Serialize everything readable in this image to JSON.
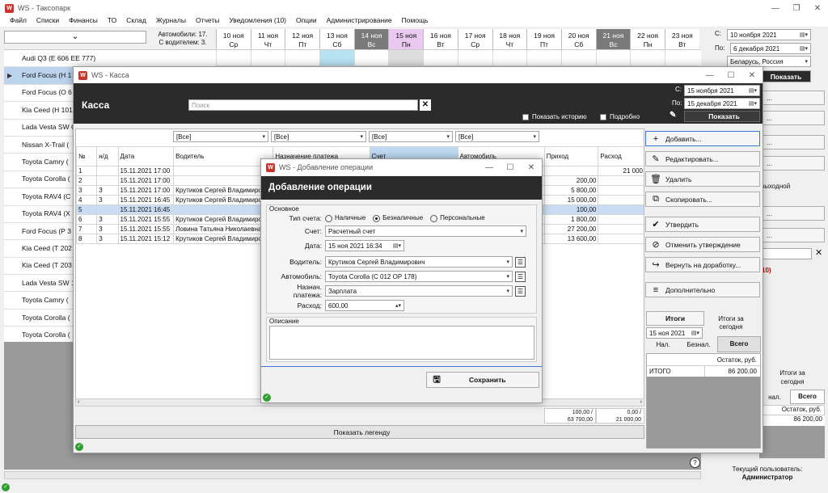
{
  "app": {
    "title": "WS - Таксопарк"
  },
  "menu": [
    "Файл",
    "Списки",
    "Финансы",
    "ТО",
    "Склад",
    "Журналы",
    "Отчеты",
    "Уведомления (10)",
    "Опции",
    "Администрирование",
    "Помощь"
  ],
  "schedule": {
    "cars_stat_1": "Автомобили: 17.",
    "cars_stat_2": "С водителем: 3.",
    "days": [
      {
        "d": "10 ноя",
        "w": "Ср"
      },
      {
        "d": "11 ноя",
        "w": "Чт"
      },
      {
        "d": "12 ноя",
        "w": "Пт"
      },
      {
        "d": "13 ноя",
        "w": "Сб"
      },
      {
        "d": "14 ноя",
        "w": "Вс"
      },
      {
        "d": "15 ноя",
        "w": "Пн"
      },
      {
        "d": "16 ноя",
        "w": "Вт"
      },
      {
        "d": "17 ноя",
        "w": "Ср"
      },
      {
        "d": "18 ноя",
        "w": "Чт"
      },
      {
        "d": "19 ноя",
        "w": "Пт"
      },
      {
        "d": "20 ноя",
        "w": "Сб"
      },
      {
        "d": "21 ноя",
        "w": "Вс"
      },
      {
        "d": "22 ноя",
        "w": "Пн"
      },
      {
        "d": "23 ноя",
        "w": "Вт"
      }
    ]
  },
  "cars": [
    "Audi Q3 (Е 606 ЕЕ 777)",
    "Ford Focus (Н 1",
    "Ford Focus (О 6",
    "Kia Ceed (Н 101",
    "Lada Vesta SW C 777)",
    "Nissan X-Trail (",
    "Toyota Camry (",
    "Toyota Corolla (",
    "Toyota RAV4 (С",
    "Toyota RAV4 (Х",
    "Ford Focus (Р 3",
    "Kia Ceed (Т 202",
    "Kia Ceed (Т 203",
    "Lada Vesta SW 178)",
    "Toyota Camry (",
    "Toyota Corolla (",
    "Toyota Corolla ("
  ],
  "right_panel": {
    "s_lbl": "С:",
    "po_lbl": "По:",
    "from": "10 ноября  2021",
    "to": "6 декабря 2021",
    "region": "Беларусь, Россия",
    "show": "Показать",
    "b1": "...",
    "b2": "...",
    "b3": "...",
    "b4": "...",
    "vyh": "выходной",
    "b5": "...",
    "b6": "...",
    "red10": "10)",
    "totals_lbl": "Итоги за сегодня",
    "tab_nal": "нал.",
    "tab_all": "Всего",
    "ost": "Остаток, руб.",
    "ost_val": "86 200,00",
    "cur_user_lbl": "Текущий пользователь:",
    "cur_user": "Администратор"
  },
  "kassa": {
    "title": "WS - Касса",
    "heading": "Касса",
    "search_ph": "Поиск",
    "s_lbl": "С:",
    "po_lbl": "По:",
    "from": "15 ноября  2021",
    "to": "15 декабря 2021",
    "history": "Показать историю",
    "detail": "Подробно",
    "show": "Показать",
    "filters": [
      "[Все]",
      "[Все]",
      "[Все]",
      "[Все]"
    ],
    "columns": [
      "№",
      "н/д",
      "Дата",
      "Водитель",
      "Назначение платежа",
      "Счет",
      "Автомобиль",
      "Приход",
      "Расход"
    ],
    "rows": [
      [
        "1",
        "",
        "15.11.2021 17:00",
        "",
        "",
        "",
        "",
        "",
        "21 000"
      ],
      [
        "2",
        "",
        "15.11.2021 17:00",
        "",
        "",
        "",
        "",
        "200,00",
        ""
      ],
      [
        "3",
        "3",
        "15.11.2021 17:00",
        "Крутиков Сергей Владимиро",
        "",
        "",
        "",
        "5 800,00",
        ""
      ],
      [
        "4",
        "3",
        "15.11.2021 16:45",
        "Крутиков Сергей Владимиро",
        "",
        "",
        "",
        "15 000,00",
        ""
      ],
      [
        "5",
        "",
        "15.11.2021 16:45",
        "",
        "",
        "",
        "",
        "100,00",
        ""
      ],
      [
        "6",
        "3",
        "15.11.2021 15:55",
        "Крутиков Сергей Владимиро",
        "",
        "",
        "",
        "1 800,00",
        ""
      ],
      [
        "7",
        "3",
        "15.11.2021 15:55",
        "Ловина Татьяна Николаевна",
        "",
        "",
        "",
        "27 200,00",
        ""
      ],
      [
        "8",
        "3",
        "15.11.2021 15:12",
        "Крутиков Сергей Владимиро",
        "",
        "",
        "",
        "13 600,00",
        ""
      ]
    ],
    "sum1a": "100,00 /",
    "sum1b": "63 700,00",
    "sum2a": "0,00 /",
    "sum2b": "21 000,00",
    "legend": "Показать легенду",
    "actions": [
      "Добавить...",
      "Редактировать...",
      "Удалить",
      "Скопировать...",
      "Утвердить",
      "Отменить утверждение",
      "Вернуть на доработку...",
      "Дополнительно"
    ],
    "itogi": "Итоги",
    "itogi_today": "Итоги за сегодня",
    "itogi_date": "15 ноя 2021",
    "tab_nal": "Нал.",
    "tab_beznal": "Безнал.",
    "tab_all": "Всего",
    "ost": "Остаток, руб.",
    "itogo": "ИТОГО",
    "itogo_val": "86 200,00"
  },
  "dialog": {
    "title": "WS - Добавление операции",
    "heading": "Добавление операции",
    "group": "Основное",
    "type_lbl": "Тип счета:",
    "r1": "Наличные",
    "r2": "Безналичные",
    "r3": "Персональные",
    "schet_lbl": "Счет:",
    "schet": "Расчетный счет",
    "date_lbl": "Дата:",
    "date": "15 ноя  2021  16:34",
    "driver_lbl": "Водитель:",
    "driver": "Крутиков Сергей Владимирович",
    "car_lbl": "Автомобиль:",
    "car": "Toyota Corolla (С 012 ОР 178)",
    "purpose_lbl": "Назнач. платежа:",
    "purpose": "Зарплата",
    "rashod_lbl": "Расход:",
    "rashod": "600,00",
    "desc_lbl": "Описание",
    "save": "Сохранить"
  }
}
